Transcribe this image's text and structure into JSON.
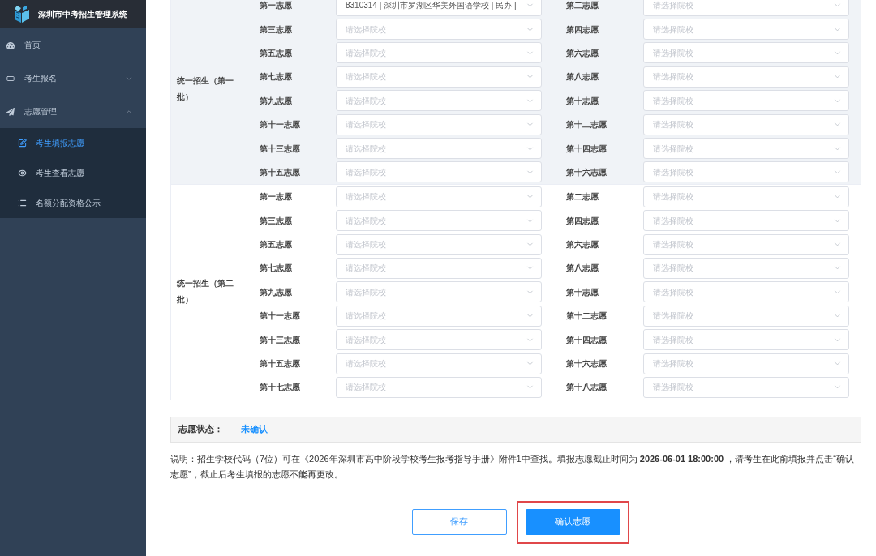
{
  "sidebar": {
    "title": "深圳市中考招生管理系统",
    "items": [
      {
        "label": "首页",
        "kind": "link"
      },
      {
        "label": "考生报名",
        "kind": "group",
        "expanded": false
      },
      {
        "label": "志愿管理",
        "kind": "group",
        "expanded": true,
        "children": [
          {
            "label": "考生填报志愿",
            "selected": true
          },
          {
            "label": "考生查看志愿",
            "selected": false
          },
          {
            "label": "名额分配资格公示",
            "selected": false
          }
        ]
      }
    ]
  },
  "choice_table": {
    "groups": [
      {
        "label": "统一招生（第一批）",
        "highlighted": true,
        "choices": [
          {
            "label": "第一志愿",
            "value": "8310314 | 深圳市罗湖区华美外国语学校 | 民办 |"
          },
          {
            "label": "第二志愿",
            "placeholder": "请选择院校"
          },
          {
            "label": "第三志愿",
            "placeholder": "请选择院校"
          },
          {
            "label": "第四志愿",
            "placeholder": "请选择院校"
          },
          {
            "label": "第五志愿",
            "placeholder": "请选择院校"
          },
          {
            "label": "第六志愿",
            "placeholder": "请选择院校"
          },
          {
            "label": "第七志愿",
            "placeholder": "请选择院校"
          },
          {
            "label": "第八志愿",
            "placeholder": "请选择院校"
          },
          {
            "label": "第九志愿",
            "placeholder": "请选择院校"
          },
          {
            "label": "第十志愿",
            "placeholder": "请选择院校"
          },
          {
            "label": "第十一志愿",
            "placeholder": "请选择院校"
          },
          {
            "label": "第十二志愿",
            "placeholder": "请选择院校"
          },
          {
            "label": "第十三志愿",
            "placeholder": "请选择院校"
          },
          {
            "label": "第十四志愿",
            "placeholder": "请选择院校"
          },
          {
            "label": "第十五志愿",
            "placeholder": "请选择院校"
          },
          {
            "label": "第十六志愿",
            "placeholder": "请选择院校"
          }
        ]
      },
      {
        "label": "统一招生（第二批）",
        "highlighted": false,
        "choices": [
          {
            "label": "第一志愿",
            "placeholder": "请选择院校"
          },
          {
            "label": "第二志愿",
            "placeholder": "请选择院校"
          },
          {
            "label": "第三志愿",
            "placeholder": "请选择院校"
          },
          {
            "label": "第四志愿",
            "placeholder": "请选择院校"
          },
          {
            "label": "第五志愿",
            "placeholder": "请选择院校"
          },
          {
            "label": "第六志愿",
            "placeholder": "请选择院校"
          },
          {
            "label": "第七志愿",
            "placeholder": "请选择院校"
          },
          {
            "label": "第八志愿",
            "placeholder": "请选择院校"
          },
          {
            "label": "第九志愿",
            "placeholder": "请选择院校"
          },
          {
            "label": "第十志愿",
            "placeholder": "请选择院校"
          },
          {
            "label": "第十一志愿",
            "placeholder": "请选择院校"
          },
          {
            "label": "第十二志愿",
            "placeholder": "请选择院校"
          },
          {
            "label": "第十三志愿",
            "placeholder": "请选择院校"
          },
          {
            "label": "第十四志愿",
            "placeholder": "请选择院校"
          },
          {
            "label": "第十五志愿",
            "placeholder": "请选择院校"
          },
          {
            "label": "第十六志愿",
            "placeholder": "请选择院校"
          },
          {
            "label": "第十七志愿",
            "placeholder": "请选择院校"
          },
          {
            "label": "第十八志愿",
            "placeholder": "请选择院校"
          }
        ]
      }
    ]
  },
  "status": {
    "label": "志愿状态：",
    "value": "未确认"
  },
  "note": "说明：招生学校代码（7位）可在《2026年深圳市高中阶段学校考生报考指导手册》附件1中查找。填报志愿截止时间为 **2026-06-01 18:00:00** ，请考生在此前填报并点击“确认志愿”，截止后考生填报的志愿不能再更改。",
  "buttons": [
    {
      "label": "保存",
      "kind": "secondary",
      "highlighted": false
    },
    {
      "label": "确认志愿",
      "kind": "primary",
      "highlighted": true
    }
  ]
}
